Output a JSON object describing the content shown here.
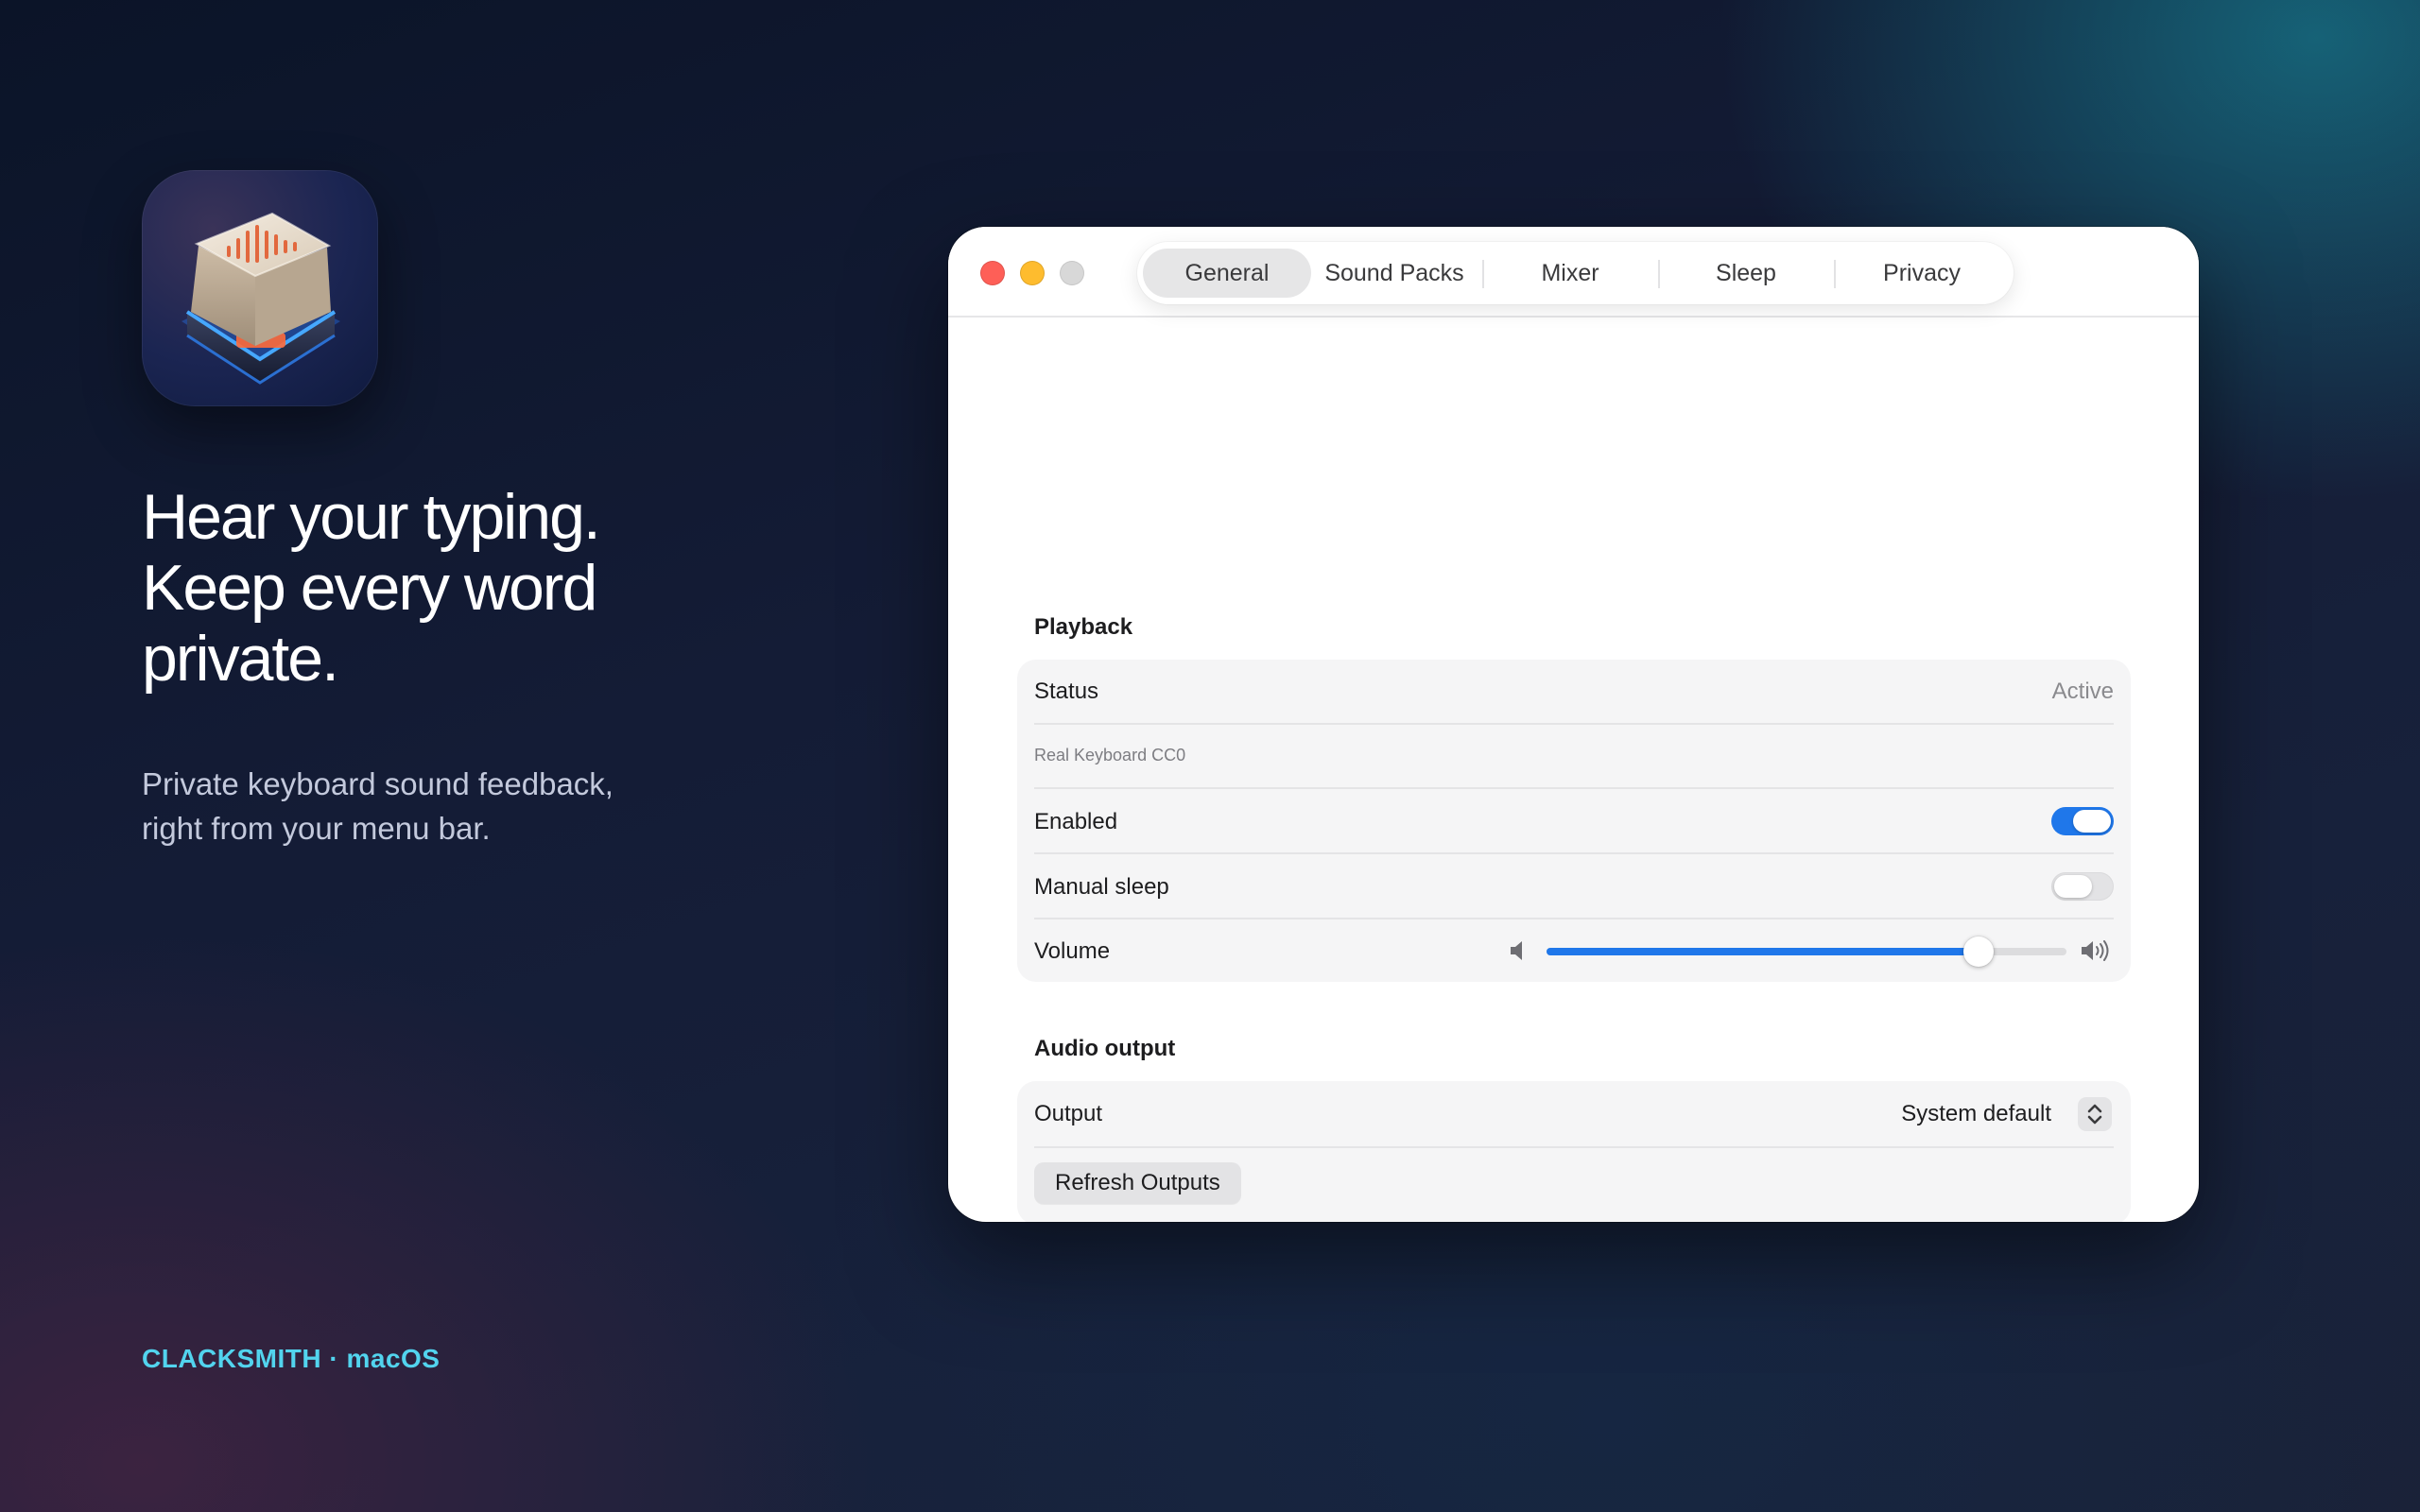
{
  "marketing": {
    "headline_line1": "Hear your typing.",
    "headline_line2": "Keep every word",
    "headline_line3": "private.",
    "subhead_line1": "Private keyboard sound feedback,",
    "subhead_line2": "right from your menu bar.",
    "brand": "CLACKSMITH · macOS",
    "app_icon": "keycap-soundwave-icon"
  },
  "window": {
    "tabs": [
      {
        "label": "General",
        "active": true
      },
      {
        "label": "Sound Packs",
        "active": false
      },
      {
        "label": "Mixer",
        "active": false
      },
      {
        "label": "Sleep",
        "active": false
      },
      {
        "label": "Privacy",
        "active": false
      }
    ]
  },
  "playback": {
    "section_title": "Playback",
    "status_label": "Status",
    "status_value": "Active",
    "sound_pack": "Real Keyboard CC0",
    "enabled_label": "Enabled",
    "enabled": true,
    "manual_sleep_label": "Manual sleep",
    "manual_sleep": false,
    "volume_label": "Volume",
    "volume_level": 0.83,
    "volume_low_icon": "speaker-low-icon",
    "volume_high_icon": "speaker-high-icon"
  },
  "audio_output": {
    "section_title": "Audio output",
    "output_label": "Output",
    "output_value": "System default",
    "refresh_label": "Refresh Outputs"
  },
  "colors": {
    "accent": "#1f77ea",
    "brand": "#52d4ee",
    "close": "#fe5f57",
    "minimize": "#febc2e"
  }
}
